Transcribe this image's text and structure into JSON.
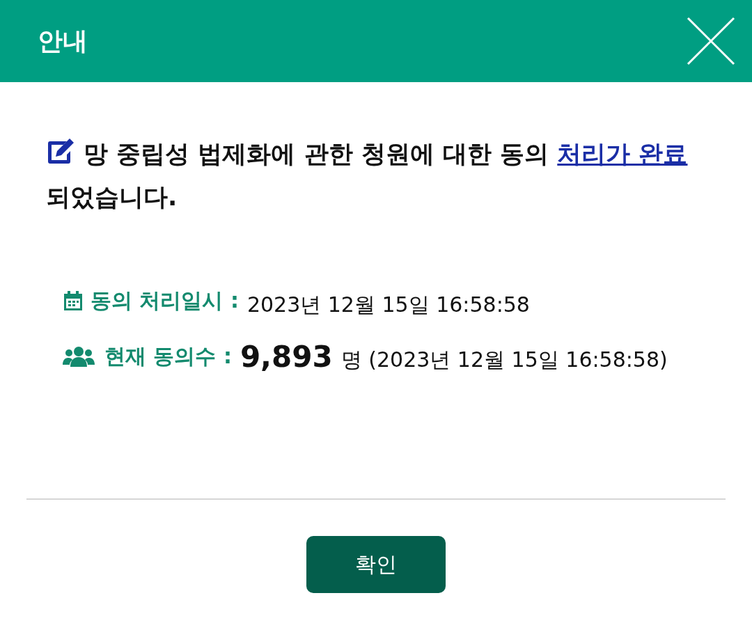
{
  "dialog": {
    "title": "안내",
    "message": {
      "before": "망 중립성 법제화에 관한 청원에 대한 동의 ",
      "link": "처리가 완료",
      "after": "되었습니다."
    },
    "details": [
      {
        "kind": "datetime",
        "label": "동의 처리일시 :",
        "value": "2023년 12월 15일 16:58:58"
      },
      {
        "kind": "count",
        "label": "현재 동의수 :",
        "count": "9,893",
        "value": "명 (2023년 12월 15일 16:58:58)"
      }
    ],
    "buttons": [
      "확인"
    ]
  }
}
